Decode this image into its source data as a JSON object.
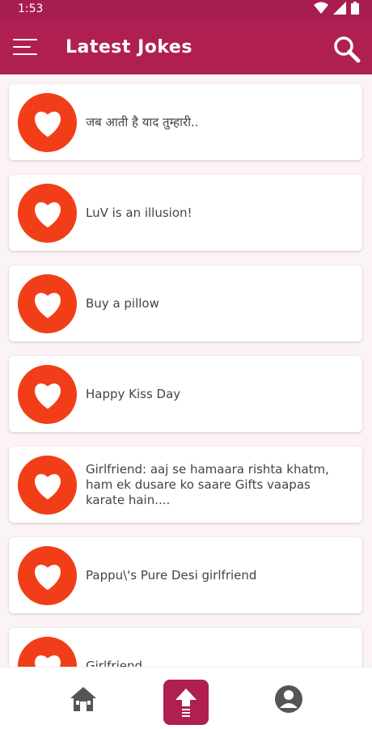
{
  "status_bar": {
    "time": "1:53",
    "icons": [
      "wifi-icon",
      "signal-icon",
      "battery-icon"
    ]
  },
  "app_bar": {
    "title": "Latest Jokes",
    "menu_icon": "menu-icon",
    "search_icon": "search-icon"
  },
  "jokes": [
    {
      "title": "जब आती है याद तुम्हारी.."
    },
    {
      "title": "LuV is an illusion!"
    },
    {
      "title": "Buy a pillow"
    },
    {
      "title": "Happy Kiss Day"
    },
    {
      "title": "Girlfriend: aaj se hamaara rishta khatm, ham ek dusare ko saare Gifts vaapas karate hain...."
    },
    {
      "title": "Pappu\\'s Pure Desi girlfriend"
    },
    {
      "title": "Girlfriend"
    }
  ],
  "bottom_nav": {
    "items": [
      "home-icon",
      "upload-icon",
      "profile-icon"
    ]
  },
  "colors": {
    "primary": "#b01f52",
    "heart_bg": "#f23e18"
  }
}
